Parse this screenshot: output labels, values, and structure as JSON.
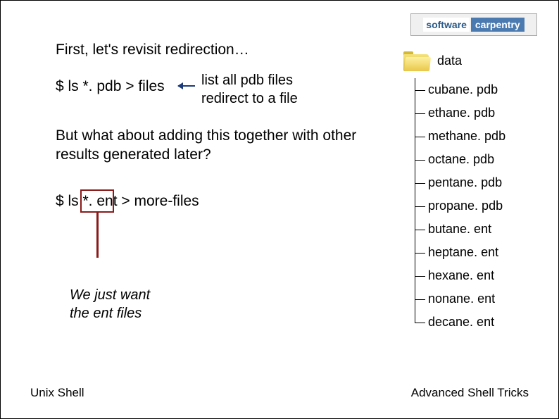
{
  "logo": {
    "word1": "software",
    "word2": "carpentry"
  },
  "heading": "First, let's revisit redirection…",
  "cmd1": "$ ls *. pdb > files",
  "callout1_line1": "list all pdb files",
  "callout1_line2": "redirect to a file",
  "body": "But what about adding this together with other results generated later?",
  "cmd2": "$ ls *. ent > more-files",
  "callout2_line1": "We just want",
  "callout2_line2": "the ent files",
  "tree": {
    "folder": "data",
    "files": [
      "cubane. pdb",
      "ethane. pdb",
      "methane. pdb",
      "octane. pdb",
      "pentane. pdb",
      "propane. pdb",
      "butane. ent",
      "heptane. ent",
      "hexane. ent",
      "nonane. ent",
      "decane. ent"
    ]
  },
  "footer": {
    "left": "Unix Shell",
    "right": "Advanced Shell Tricks"
  }
}
